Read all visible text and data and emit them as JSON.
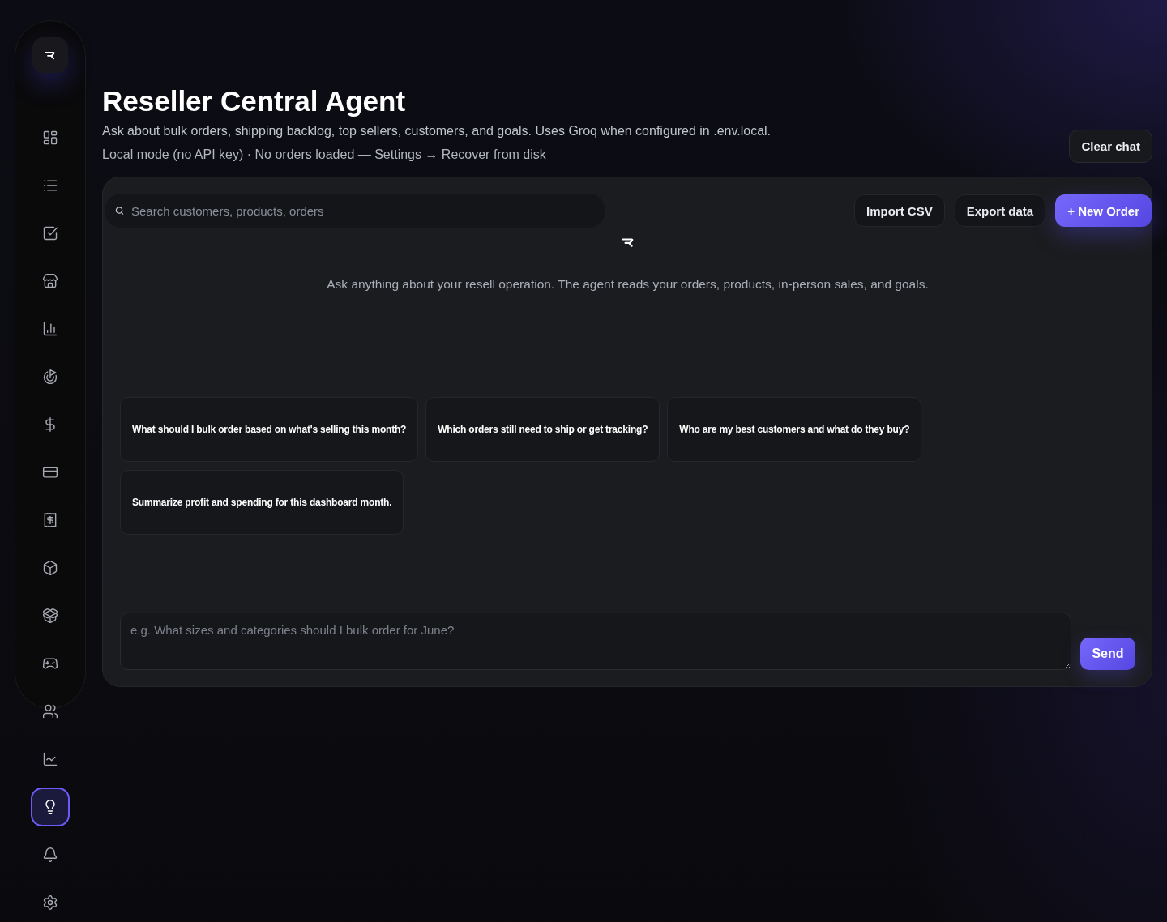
{
  "sidebar": {
    "nav_items": [
      {
        "selected": false
      },
      {
        "selected": false
      },
      {
        "selected": false
      },
      {
        "selected": false
      },
      {
        "selected": false
      },
      {
        "selected": false
      },
      {
        "selected": false
      },
      {
        "selected": false
      },
      {
        "selected": false
      },
      {
        "selected": false
      },
      {
        "selected": false
      },
      {
        "selected": false
      },
      {
        "selected": false
      },
      {
        "selected": false
      },
      {
        "selected": true
      },
      {
        "selected": false
      },
      {
        "selected": false
      }
    ]
  },
  "header": {
    "title": "Reseller Central Agent",
    "subtitle": "Ask about bulk orders, shipping backlog, top sellers, customers, and goals. Uses Groq when configured in .env.local.",
    "status": "Local mode (no API key) · No orders loaded — Settings → Recover from disk",
    "clear_button": "Clear chat"
  },
  "toolbar": {
    "search": {
      "placeholder": "Search customers, products, orders"
    },
    "buttons": [
      {
        "label": "Import CSV",
        "kind": "secondary"
      },
      {
        "label": "Export data",
        "kind": "secondary"
      },
      {
        "label": "+ New Order",
        "kind": "primary"
      }
    ]
  },
  "chat": {
    "intro": "Ask anything about your resell operation. The agent reads your orders, products, in-person sales, and goals.",
    "suggestions": [
      "What should I bulk order based on what's selling this month?",
      "Which orders still need to ship or get tracking?",
      "Who are my best customers and what do they buy?",
      "Summarize profit and spending for this dashboard month."
    ],
    "composer": {
      "placeholder": "e.g. What sizes and categories should I bulk order for June?",
      "send_button": "Send"
    }
  }
}
